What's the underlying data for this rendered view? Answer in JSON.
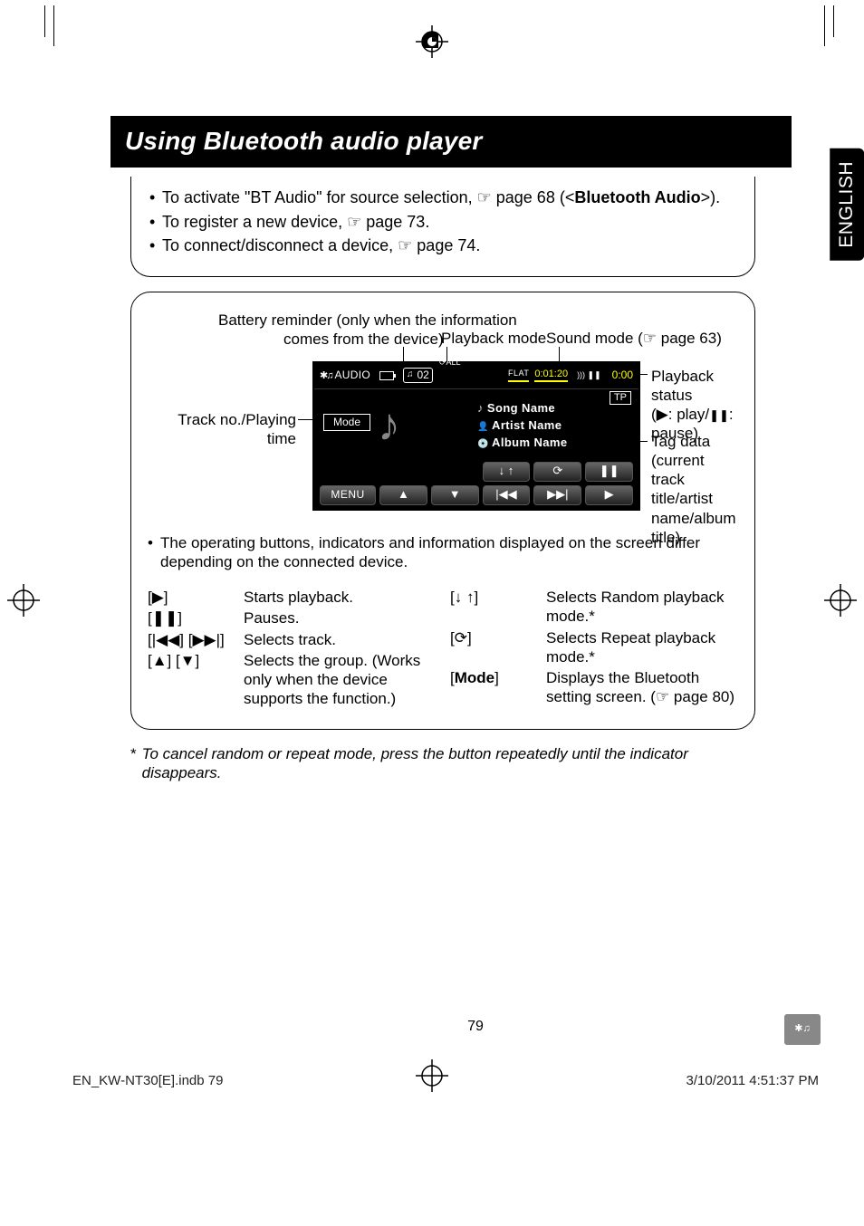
{
  "lang_tab": "ENGLISH",
  "heading": "Using Bluetooth audio player",
  "intro": {
    "bullets": [
      {
        "pre": "To activate \"BT Audio\" for source selection, ",
        "pointer": "☞",
        "post": " page 68 (<",
        "bold": "Bluetooth Audio",
        "post2": ">)."
      },
      {
        "pre": "To register a new device, ",
        "pointer": "☞",
        "post": " page 73."
      },
      {
        "pre": "To connect/disconnect a device, ",
        "pointer": "☞",
        "post": " page 74."
      }
    ]
  },
  "callouts": {
    "battery1": "Battery reminder (only when the information",
    "battery2": "comes from the device)",
    "track": "Track no./Playing time",
    "playback_mode": "Playback mode",
    "sound_mode_pre": "Sound mode (",
    "sound_mode_post": " page 63)",
    "status1": "Playback status",
    "status2_pre": "(",
    "status2_play": "▶",
    "status2_mid": ": play/",
    "status2_pause": "❚❚",
    "status2_post": ": pause)",
    "tag1": "Tag data (current track",
    "tag2": "title/artist name/album",
    "tag3": "title)"
  },
  "device": {
    "source": "AUDIO",
    "track_no": "02",
    "repeat_ind": "⟳ALL",
    "flat": "FLAT",
    "playtime": "0:01:20",
    "ms": "))) ❚❚",
    "clock": "0:00",
    "tp": "TP",
    "song": "Song Name",
    "artist": "Artist Name",
    "album": "Album Name",
    "mode_btn": "Mode",
    "menu_btn": "MENU",
    "row1": [
      "↓ ↑",
      "⟳",
      "❚❚"
    ],
    "row2": [
      "▲",
      "▼",
      "|◀◀",
      "▶▶|",
      "▶"
    ]
  },
  "panel_note": "The operating buttons, indicators and information displayed on the screen differ depending on the connected device.",
  "controls_left": [
    {
      "key": "[▶]",
      "desc": "Starts playback."
    },
    {
      "key": "[❚❚]",
      "desc": "Pauses."
    },
    {
      "key": "[|◀◀] [▶▶|]",
      "desc": "Selects track."
    },
    {
      "key": "[▲] [▼]",
      "desc": "Selects the group. (Works only when the device supports the function.)"
    }
  ],
  "controls_right": [
    {
      "key": "[↓ ↑]",
      "desc": "Selects Random playback mode.*"
    },
    {
      "key": "[⟳]",
      "desc": "Selects Repeat playback mode.*"
    },
    {
      "key_pre": "[",
      "key_bold": "Mode",
      "key_post": "]",
      "desc_pre": "Displays the Bluetooth setting screen. (",
      "pointer": "☞",
      "desc_post": " page 80)"
    }
  ],
  "footnote": {
    "ast": "*",
    "text": "To cancel random or repeat mode, press the button repeatedly until the indicator disappears."
  },
  "page_no": "79",
  "bt_badge": "✱♫",
  "footer": {
    "left": "EN_KW-NT30[E].indb   79",
    "right": "3/10/2011   4:51:37 PM"
  }
}
